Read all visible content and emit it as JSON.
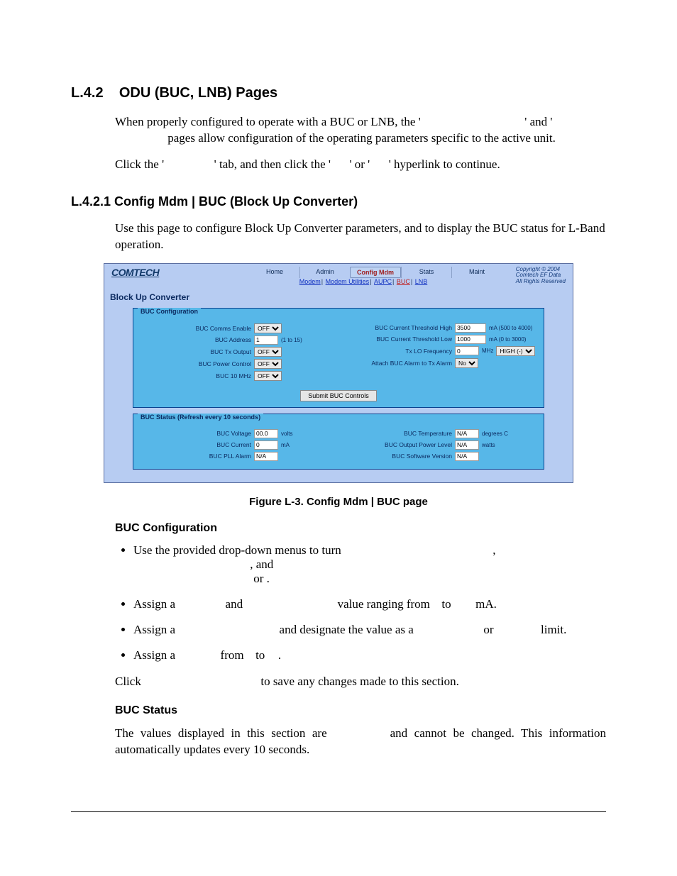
{
  "section": {
    "number": "L.4.2",
    "title": "ODU (BUC, LNB) Pages"
  },
  "para1a": "When properly configured to operate with a BUC or LNB, the '",
  "para1b": "' and '",
  "para1c": "pages allow configuration of the operating parameters specific to the active unit.",
  "para2a": "Click the '",
  "para2b": "' tab, and then click the '",
  "para2c": "' or '",
  "para2d": "' hyperlink to continue.",
  "subsection": {
    "number": "L.4.2.1",
    "title": "Config Mdm | BUC (Block Up Converter)"
  },
  "para3": "Use this page to configure Block Up Converter parameters, and to display the BUC status for L-Band operation.",
  "figure_caption": "Figure L-3. Config Mdm | BUC page",
  "shot": {
    "logo": "COMTECH",
    "tabs": [
      "Home",
      "Admin",
      "Config Mdm",
      "Stats",
      "Maint"
    ],
    "active_tab": 2,
    "sublinks": [
      "Modem",
      "Modem Utilities",
      "AUPC",
      "BUC",
      "LNB"
    ],
    "hot_sublink": 3,
    "copyright": [
      "Copyright © 2004",
      "Comtech EF Data",
      "All Rights Reserved"
    ],
    "panel_title": "Block Up Converter",
    "config": {
      "legend": "BUC Configuration",
      "left": [
        {
          "label": "BUC Comms Enable",
          "type": "select",
          "value": "OFF"
        },
        {
          "label": "BUC Address",
          "type": "text",
          "value": "1",
          "suffix": "(1 to 15)"
        },
        {
          "label": "BUC Tx Output",
          "type": "select",
          "value": "OFF"
        },
        {
          "label": "BUC Power Control",
          "type": "select",
          "value": "OFF"
        },
        {
          "label": "BUC 10 MHz",
          "type": "select",
          "value": "OFF"
        }
      ],
      "right": [
        {
          "label": "BUC Current Threshold High",
          "type": "text",
          "value": "3500",
          "suffix": "mA (500 to 4000)"
        },
        {
          "label": "BUC Current Threshold Low",
          "type": "text",
          "value": "1000",
          "suffix": "mA (0 to 3000)"
        },
        {
          "label": "Tx LO Frequency",
          "type": "text",
          "value": "0",
          "suffix": "MHz",
          "extra_select": "HIGH (-)"
        },
        {
          "label": "Attach BUC Alarm to Tx Alarm",
          "type": "select",
          "value": "No"
        }
      ],
      "submit": "Submit BUC Controls"
    },
    "status": {
      "legend": "BUC Status (Refresh every 10 seconds)",
      "left": [
        {
          "label": "BUC Voltage",
          "value": "00.0",
          "suffix": "volts"
        },
        {
          "label": "BUC Current",
          "value": "0",
          "suffix": "mA"
        },
        {
          "label": "BUC PLL Alarm",
          "value": "N/A"
        }
      ],
      "right": [
        {
          "label": "BUC Temperature",
          "value": "N/A",
          "suffix": "degrees C"
        },
        {
          "label": "BUC Output Power Level",
          "value": "N/A",
          "suffix": "watts"
        },
        {
          "label": "BUC Software Version",
          "value": "N/A"
        }
      ]
    }
  },
  "head_config": "BUC Configuration",
  "bullets": [
    {
      "a": "Use the provided drop-down menus to turn ",
      "b": ", ",
      "c": ", and",
      "d": " or ",
      "e": "."
    },
    {
      "a": "Assign a ",
      "b": " and ",
      "c": " value ranging from ",
      "d": " to ",
      "e": " mA."
    },
    {
      "a": "Assign a ",
      "b": " and designate the value as a ",
      "c": " or ",
      "d": " limit."
    },
    {
      "a": "Assign a ",
      "b": " from ",
      "c": " to ",
      "d": "."
    }
  ],
  "click_save_a": "Click ",
  "click_save_b": " to save any changes made to this section.",
  "head_status": "BUC Status",
  "status_para_a": "The values displayed in this section are ",
  "status_para_b": " and cannot be changed. This information automatically updates every 10 seconds."
}
